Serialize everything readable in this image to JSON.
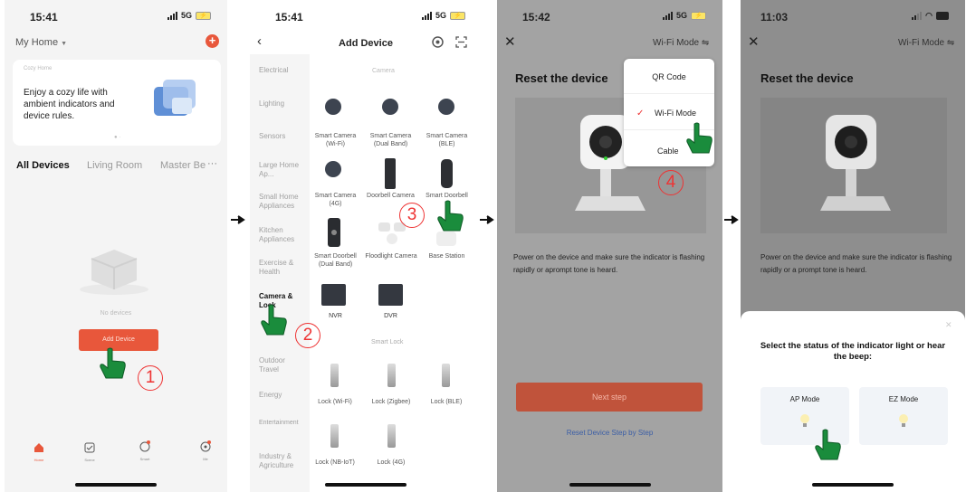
{
  "colors": {
    "accent": "#e8573b",
    "green": "#1a8c3c",
    "red": "#e33333"
  },
  "steps": [
    "1",
    "2",
    "3",
    "4"
  ],
  "screen1": {
    "time": "15:41",
    "network": "5G",
    "home_selector": "My Home",
    "banner_label": "Cozy Home",
    "banner_text": "Enjoy a cozy life with ambient indicators and device rules.",
    "tabs": [
      "All Devices",
      "Living Room",
      "Master Be"
    ],
    "more": "···",
    "empty_text": "No devices",
    "add_button": "Add Device",
    "nav": [
      "Home",
      "Scene",
      "Smart",
      "Me"
    ]
  },
  "screen2": {
    "time": "15:41",
    "network": "5G",
    "title": "Add Device",
    "categories": [
      "Electrical",
      "Lighting",
      "Sensors",
      "Large Home Ap...",
      "Small Home Appliances",
      "Kitchen Appliances",
      "Exercise & Health",
      "Camera & Lock",
      "Outdoor Travel",
      "Energy",
      "Entertainment",
      "Industry & Agriculture"
    ],
    "camera_header": "Camera",
    "devices": [
      {
        "name": "Smart Camera (Wi-Fi)",
        "icon": "camera-icon"
      },
      {
        "name": "Smart Camera (Dual Band)",
        "icon": "camera-icon"
      },
      {
        "name": "Smart Camera (BLE)",
        "icon": "camera-icon"
      },
      {
        "name": "Smart Camera (4G)",
        "icon": "camera-icon"
      },
      {
        "name": "Doorbell Camera",
        "icon": "doorbell-icon"
      },
      {
        "name": "Smart Doorbell",
        "icon": "doorbell-icon"
      },
      {
        "name": "Smart Doorbell (Dual Band)",
        "icon": "doorbell-icon"
      },
      {
        "name": "Floodlight Camera",
        "icon": "floodlight-icon"
      },
      {
        "name": "Base Station",
        "icon": "base-station-icon"
      },
      {
        "name": "NVR",
        "icon": "nvr-icon"
      },
      {
        "name": "DVR",
        "icon": "dvr-icon"
      }
    ],
    "lock_header": "Smart Lock",
    "locks": [
      "Lock (Wi-Fi)",
      "Lock (Zigbee)",
      "Lock (BLE)",
      "Lock (NB-IoT)",
      "Lock (4G)"
    ]
  },
  "screen3": {
    "time": "15:42",
    "network": "5G",
    "mode_label": "Wi-Fi Mode",
    "title": "Reset the device",
    "menu": [
      "QR Code",
      "Wi-Fi Mode",
      "Cable"
    ],
    "instruction": "Power on the device and make sure the indicator is flashing rapidly or aprompt tone is heard.",
    "next_button": "Next step",
    "reset_link": "Reset Device Step by Step"
  },
  "screen4": {
    "time": "11:03",
    "mode_label": "Wi-Fi Mode",
    "title": "Reset the device",
    "instruction": "Power on the device and make sure the indicator is flashing rapidly or a prompt tone is heard.",
    "sheet_title": "Select the status of the indicator light or hear the beep:",
    "options": [
      "AP Mode",
      "EZ Mode"
    ]
  }
}
